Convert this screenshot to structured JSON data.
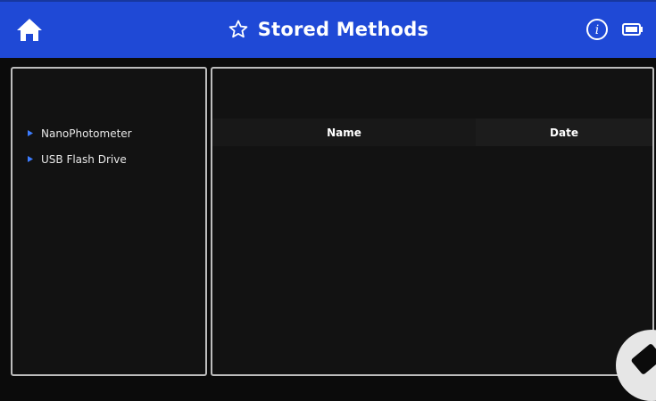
{
  "header": {
    "title": "Stored Methods",
    "home_icon": "home-icon",
    "title_icon": "star-outline-icon",
    "info_icon": "info-icon",
    "battery_icon": "battery-icon",
    "accent_color": "#1f49d6"
  },
  "sidebar": {
    "items": [
      {
        "label": "NanoPhotometer",
        "icon": "caret-right-icon"
      },
      {
        "label": "USB Flash Drive",
        "icon": "caret-right-icon"
      }
    ]
  },
  "table": {
    "columns": [
      "Name",
      "Date"
    ],
    "rows": []
  }
}
